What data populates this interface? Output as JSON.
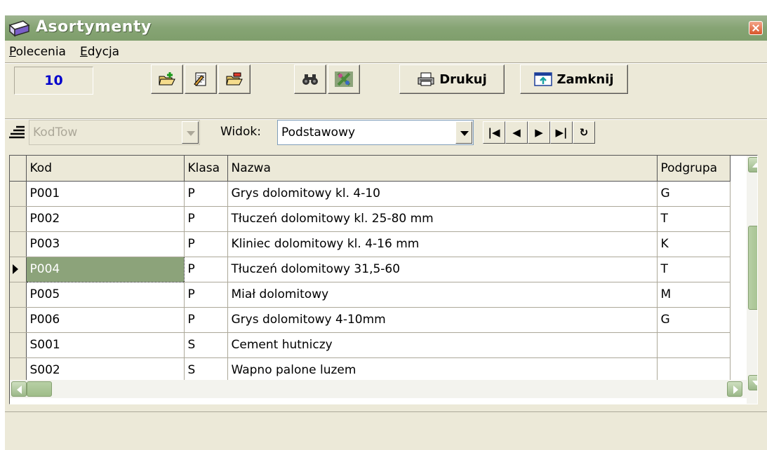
{
  "window": {
    "title": "Asortymenty",
    "accent": "#86a474"
  },
  "menu": {
    "items": [
      "Polecenia",
      "Edycja"
    ]
  },
  "toolbar": {
    "counter": "10",
    "buttons": [
      {
        "icon": "folder-add-icon"
      },
      {
        "icon": "edit-document-icon"
      },
      {
        "icon": "folder-delete-icon"
      },
      {
        "icon": "binoculars-icon"
      },
      {
        "icon": "filter-icon"
      }
    ],
    "print_label": "Drukuj",
    "close_label": "Zamknij"
  },
  "nav": {
    "sort_field": "KodTow",
    "view_label": "Widok:",
    "view_value": "Podstawowy",
    "buttons": [
      "first-record-icon",
      "prior-record-icon",
      "next-record-icon",
      "last-record-icon",
      "refresh-icon"
    ]
  },
  "grid": {
    "columns": [
      "Kod",
      "Klasa",
      "Nazwa",
      "Podgrupa"
    ],
    "rows": [
      [
        "P001",
        "P",
        "Grys dolomitowy kl. 4-10",
        "G"
      ],
      [
        "P002",
        "P",
        "Tłuczeń dolomitowy kl. 25-80 mm",
        "T"
      ],
      [
        "P003",
        "P",
        "Kliniec dolomitowy kl. 4-16 mm",
        "K"
      ],
      [
        "P004",
        "P",
        "Tłuczeń dolomitowy 31,5-60",
        "T"
      ],
      [
        "P005",
        "P",
        "Miał dolomitowy",
        "M"
      ],
      [
        "P006",
        "P",
        "Grys dolomitowy 4-10mm",
        "G"
      ],
      [
        "S001",
        "S",
        "Cement hutniczy",
        ""
      ],
      [
        "S002",
        "S",
        "Wapno palone luzem",
        ""
      ]
    ],
    "selected_row": 3
  }
}
